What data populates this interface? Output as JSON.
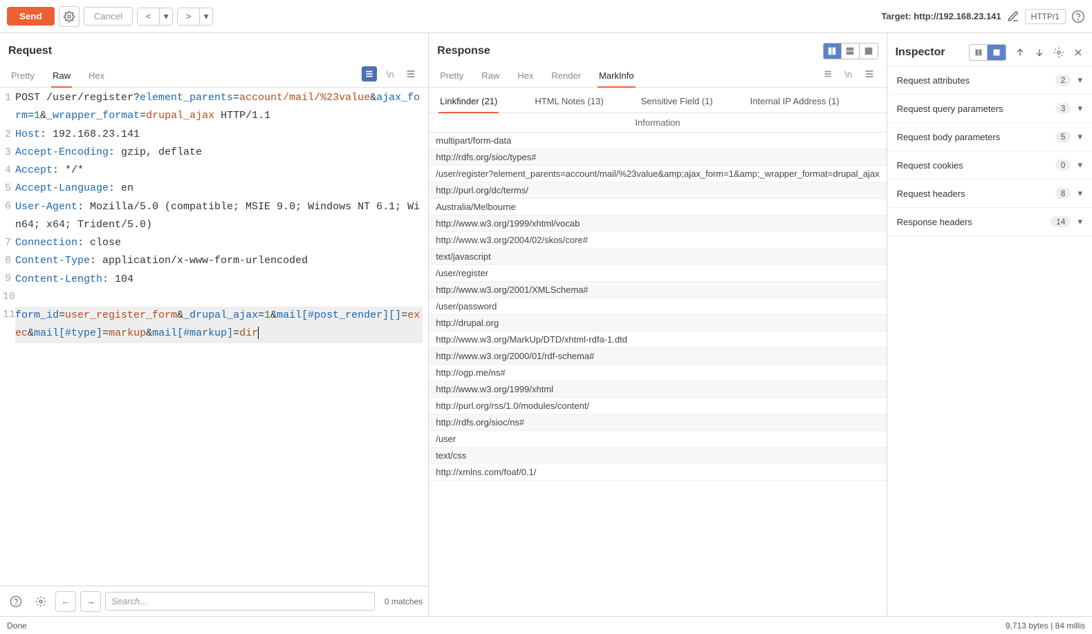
{
  "toolbar": {
    "send": "Send",
    "cancel": "Cancel",
    "target_label": "Target:",
    "target_url": "http://192.168.23.141",
    "protocol": "HTTP/1"
  },
  "request": {
    "title": "Request",
    "tabs": [
      "Pretty",
      "Raw",
      "Hex"
    ],
    "active_tab": "Raw",
    "lines": [
      {
        "n": 1,
        "html": "POST /user/register?<span class='sx-attr'>element_parents</span>=<span class='sx-val'>account/mail/%23value</span>&<span class='sx-attr'>ajax_form</span>=<span class='sx-num'>1</span>&<span class='sx-attr'>_wrapper_format</span>=<span class='sx-val'>drupal_ajax</span> HTTP/1.1"
      },
      {
        "n": 2,
        "html": "<span class='sx-attr'>Host</span>: 192.168.23.141"
      },
      {
        "n": 3,
        "html": "<span class='sx-attr'>Accept-Encoding</span>: gzip, deflate"
      },
      {
        "n": 4,
        "html": "<span class='sx-attr'>Accept</span>: */*"
      },
      {
        "n": 5,
        "html": "<span class='sx-attr'>Accept-Language</span>: en"
      },
      {
        "n": 6,
        "html": "<span class='sx-attr'>User-Agent</span>: Mozilla/5.0 (compatible; MSIE 9.0; Windows NT 6.1; Win64; x64; Trident/5.0)"
      },
      {
        "n": 7,
        "html": "<span class='sx-attr'>Connection</span>: close"
      },
      {
        "n": 8,
        "html": "<span class='sx-attr'>Content-Type</span>: application/x-www-form-urlencoded"
      },
      {
        "n": 9,
        "html": "<span class='sx-attr'>Content-Length</span>: 104"
      },
      {
        "n": 10,
        "html": ""
      },
      {
        "n": 11,
        "html": "<span class='sx-attr'>form_id</span>=<span class='sx-val'>user_register_form</span>&<span class='sx-attr'>_drupal_ajax</span>=<span class='sx-num'>1</span>&<span class='sx-attr'>mail[#post_render][]</span>=<span class='sx-val'>exec</span>&<span class='sx-attr'>mail[#type]</span>=<span class='sx-val'>markup</span>&<span class='sx-attr'>mail[#markup]</span>=<span class='sx-val'>dir</span><span class='cursor-mark'></span>",
        "hl": true
      }
    ],
    "search_placeholder": "Search...",
    "matches": "0 matches"
  },
  "response": {
    "title": "Response",
    "tabs": [
      "Pretty",
      "Raw",
      "Hex",
      "Render",
      "MarkInfo"
    ],
    "active_tab": "MarkInfo",
    "subtabs": [
      {
        "label": "Linkfinder (21)",
        "active": true
      },
      {
        "label": "HTML Notes (13)",
        "active": false
      },
      {
        "label": "Sensitive Field (1)",
        "active": false
      },
      {
        "label": "Internal IP Address (1)",
        "active": false
      }
    ],
    "info_header": "Information",
    "rows": [
      "multipart/form-data",
      "http://rdfs.org/sioc/types#",
      "/user/register?element_parents=account/mail/%23value&amp;ajax_form=1&amp;_wrapper_format=drupal_ajax",
      "http://purl.org/dc/terms/",
      "Australia/Melbourne",
      "http://www.w3.org/1999/xhtml/vocab",
      "http://www.w3.org/2004/02/skos/core#",
      "text/javascript",
      "/user/register",
      "http://www.w3.org/2001/XMLSchema#",
      "/user/password",
      "http://drupal.org",
      "http://www.w3.org/MarkUp/DTD/xhtml-rdfa-1.dtd",
      "http://www.w3.org/2000/01/rdf-schema#",
      "http://ogp.me/ns#",
      "http://www.w3.org/1999/xhtml",
      "http://purl.org/rss/1.0/modules/content/",
      "http://rdfs.org/sioc/ns#",
      "/user",
      "text/css",
      "http://xmlns.com/foaf/0.1/"
    ]
  },
  "inspector": {
    "title": "Inspector",
    "sections": [
      {
        "label": "Request attributes",
        "count": 2
      },
      {
        "label": "Request query parameters",
        "count": 3
      },
      {
        "label": "Request body parameters",
        "count": 5
      },
      {
        "label": "Request cookies",
        "count": 0
      },
      {
        "label": "Request headers",
        "count": 8
      },
      {
        "label": "Response headers",
        "count": 14
      }
    ]
  },
  "status": {
    "left": "Done",
    "right": "9,713 bytes | 84 millis"
  }
}
